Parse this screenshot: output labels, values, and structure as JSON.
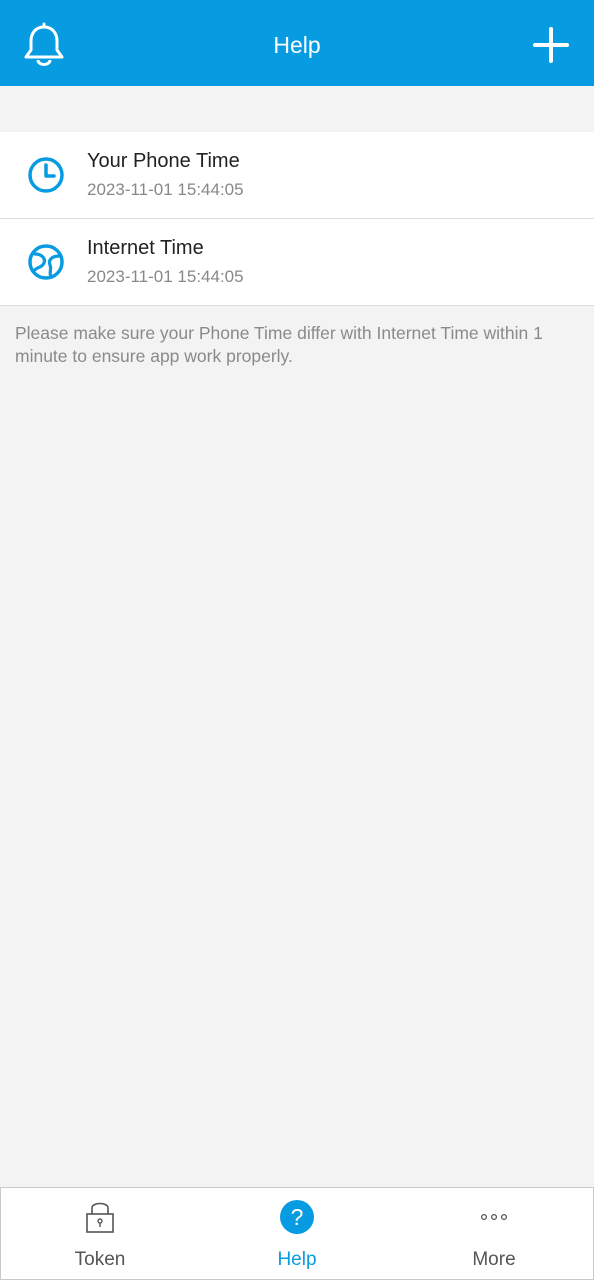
{
  "header": {
    "title": "Help",
    "left_icon": "bell-icon",
    "right_icon": "plus-icon",
    "color": "#079be2"
  },
  "times": [
    {
      "label": "Your Phone Time",
      "value": "2023-11-01 15:44:05",
      "icon": "clock-icon"
    },
    {
      "label": "Internet Time",
      "value": "2023-11-01 15:44:05",
      "icon": "globe-icon"
    }
  ],
  "note": "Please make sure your Phone Time differ with Internet Time within 1 minute to ensure app work properly.",
  "tabs": [
    {
      "label": "Token",
      "icon": "lock-icon",
      "active": false
    },
    {
      "label": "Help",
      "icon": "help-icon",
      "active": true
    },
    {
      "label": "More",
      "icon": "more-icon",
      "active": false
    }
  ]
}
